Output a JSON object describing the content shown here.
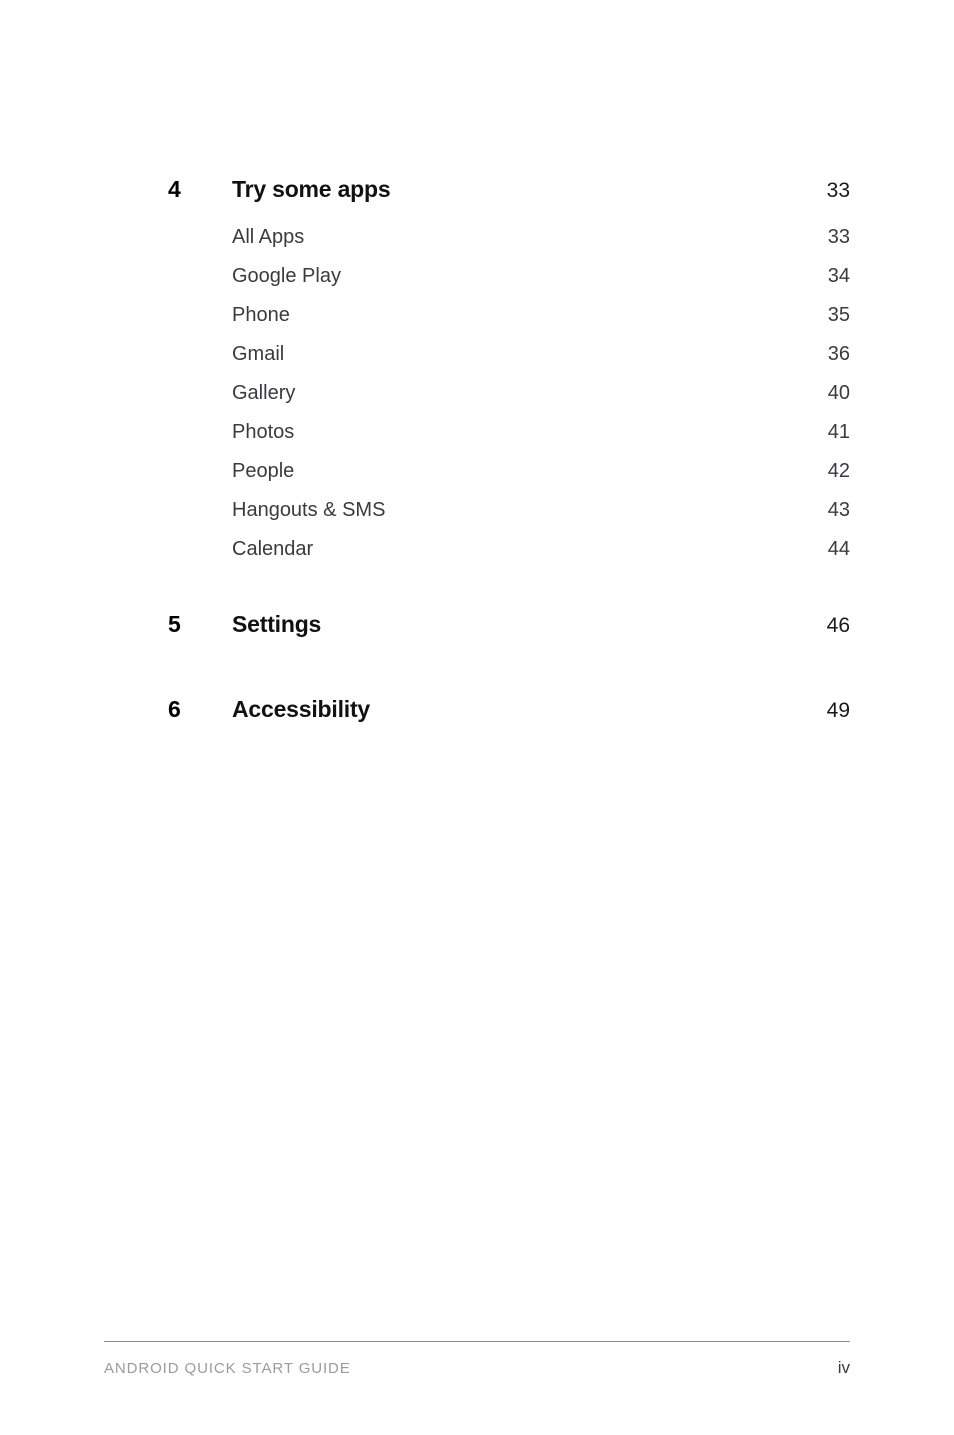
{
  "document": {
    "type": "table-of-contents",
    "page_label": "iv",
    "footer_title": "ANDROID QUICK START GUIDE",
    "colors": {
      "background": "#ffffff",
      "heading_text": "#111111",
      "entry_text": "#3b3b3f",
      "footer_text": "#9b9ba0",
      "rule": "#8e8e93"
    }
  },
  "toc": {
    "chapters": [
      {
        "number": "4",
        "title": "Try some apps",
        "page": "33",
        "entries": [
          {
            "label": "All Apps",
            "page": "33"
          },
          {
            "label": "Google Play",
            "page": "34"
          },
          {
            "label": "Phone",
            "page": "35"
          },
          {
            "label": "Gmail",
            "page": "36"
          },
          {
            "label": "Gallery",
            "page": "40"
          },
          {
            "label": "Photos",
            "page": "41"
          },
          {
            "label": "People",
            "page": "42"
          },
          {
            "label": "Hangouts & SMS",
            "page": "43"
          },
          {
            "label": "Calendar",
            "page": "44"
          }
        ]
      },
      {
        "number": "5",
        "title": "Settings",
        "page": "46",
        "entries": []
      },
      {
        "number": "6",
        "title": "Accessibility",
        "page": "49",
        "entries": []
      }
    ]
  }
}
